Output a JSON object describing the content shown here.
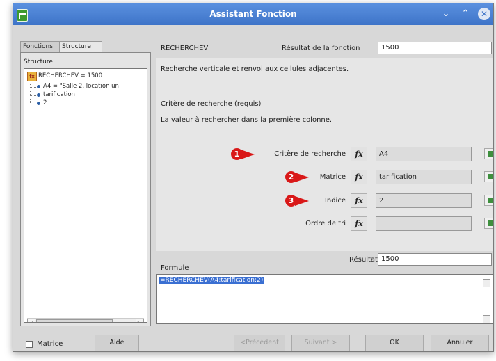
{
  "window": {
    "title": "Assistant Fonction",
    "accent": "#3e74c8"
  },
  "tabs": [
    {
      "label": "Fonctions"
    },
    {
      "label": "Structure"
    }
  ],
  "structure": {
    "label": "Structure",
    "root": "RECHERCHEV = 1500",
    "items": [
      "A4 = \"Salle 2, location un",
      "tarification",
      "2"
    ]
  },
  "function": {
    "name": "RECHERCHEV",
    "result_label": "Résultat de la fonction",
    "result_value": "1500",
    "description": "Recherche verticale et renvoi aux cellules adjacentes.",
    "criteria_title": "Critère de recherche (requis)",
    "criteria_desc": "La valeur à rechercher dans la première colonne."
  },
  "arguments": [
    {
      "badge": "1",
      "label": "Critère de recherche",
      "value": "A4"
    },
    {
      "badge": "2",
      "label": "Matrice",
      "value": "tarification"
    },
    {
      "badge": "3",
      "label": "Indice",
      "value": "2"
    },
    {
      "badge": "",
      "label": "Ordre de tri",
      "value": ""
    }
  ],
  "fx_symbol": "fx",
  "formula": {
    "label": "Formule",
    "text": "=RECHERCHEV(A4;tarification;2)"
  },
  "result": {
    "label": "Résultat",
    "value": "1500"
  },
  "buttons": {
    "matrix_check": "Matrice",
    "help": "Aide",
    "previous": "<Précédent",
    "next": "Suivant >",
    "ok": "OK",
    "cancel": "Annuler"
  },
  "colors": {
    "badge": "#d91818",
    "selection": "#3a6fd2"
  },
  "icons": {
    "app": "calc-app-icon",
    "minimize": "chevron-down-icon",
    "maximize": "chevron-up-icon",
    "close": "close-icon",
    "function": "function-icon",
    "shrink": "shrink-icon"
  }
}
